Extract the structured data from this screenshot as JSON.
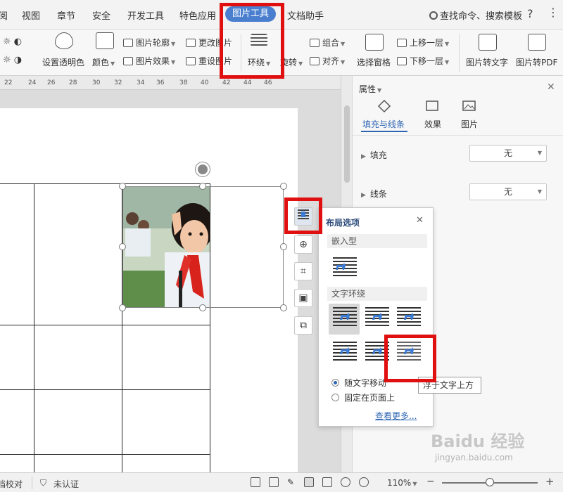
{
  "menubar": {
    "items": [
      "阅",
      "视图",
      "章节",
      "安全",
      "开发工具",
      "特色应用",
      "图片工具",
      "文档助手"
    ],
    "active_index": 6,
    "search": "查找命令、搜索模板",
    "help": "?",
    "more": "⋮"
  },
  "ribbon": {
    "set_transparent": "设置透明色",
    "color": "颜色",
    "picture_outline": "图片轮廓",
    "picture_effect": "图片效果",
    "change_picture": "更改图片",
    "reset_picture": "重设图片",
    "wrap": "环绕",
    "rotate": "旋转",
    "group": "组合",
    "align": "对齐",
    "selection_pane": "选择窗格",
    "bring_forward": "上移一层",
    "send_backward": "下移一层",
    "pic_to_text": "图片转文字",
    "pic_to_pdf": "图片转PDF"
  },
  "ruler": {
    "ticks": [
      "22",
      "24",
      "26",
      "28",
      "30",
      "32",
      "34",
      "36",
      "38",
      "40",
      "42",
      "44",
      "46"
    ]
  },
  "properties": {
    "title": "属性",
    "tabs": [
      "填充与线条",
      "效果",
      "图片"
    ],
    "active_tab_index": 0,
    "fill_label": "填充",
    "fill_value": "无",
    "line_label": "线条",
    "line_value": "无"
  },
  "popup": {
    "title": "布局选项",
    "inline_section": "嵌入型",
    "wrap_section": "文字环绕",
    "move_with_text": "随文字移动",
    "fix_on_page": "固定在页面上",
    "see_more": "查看更多...",
    "selected_wrap_index": 0
  },
  "tooltip": "浮于文字上方",
  "statusbar": {
    "proofread": "档校对",
    "unverified": "未认证",
    "zoom": "110%",
    "zoom_level_percent": 110
  },
  "watermark": {
    "brand": "Baidu 经验",
    "url": "jingyan.baidu.com"
  },
  "colors": {
    "accent": "#4a7fd0",
    "highlight_red": "#e01010",
    "link_blue": "#2d65b3",
    "wrap_icon_blue": "#3a7bd5"
  }
}
